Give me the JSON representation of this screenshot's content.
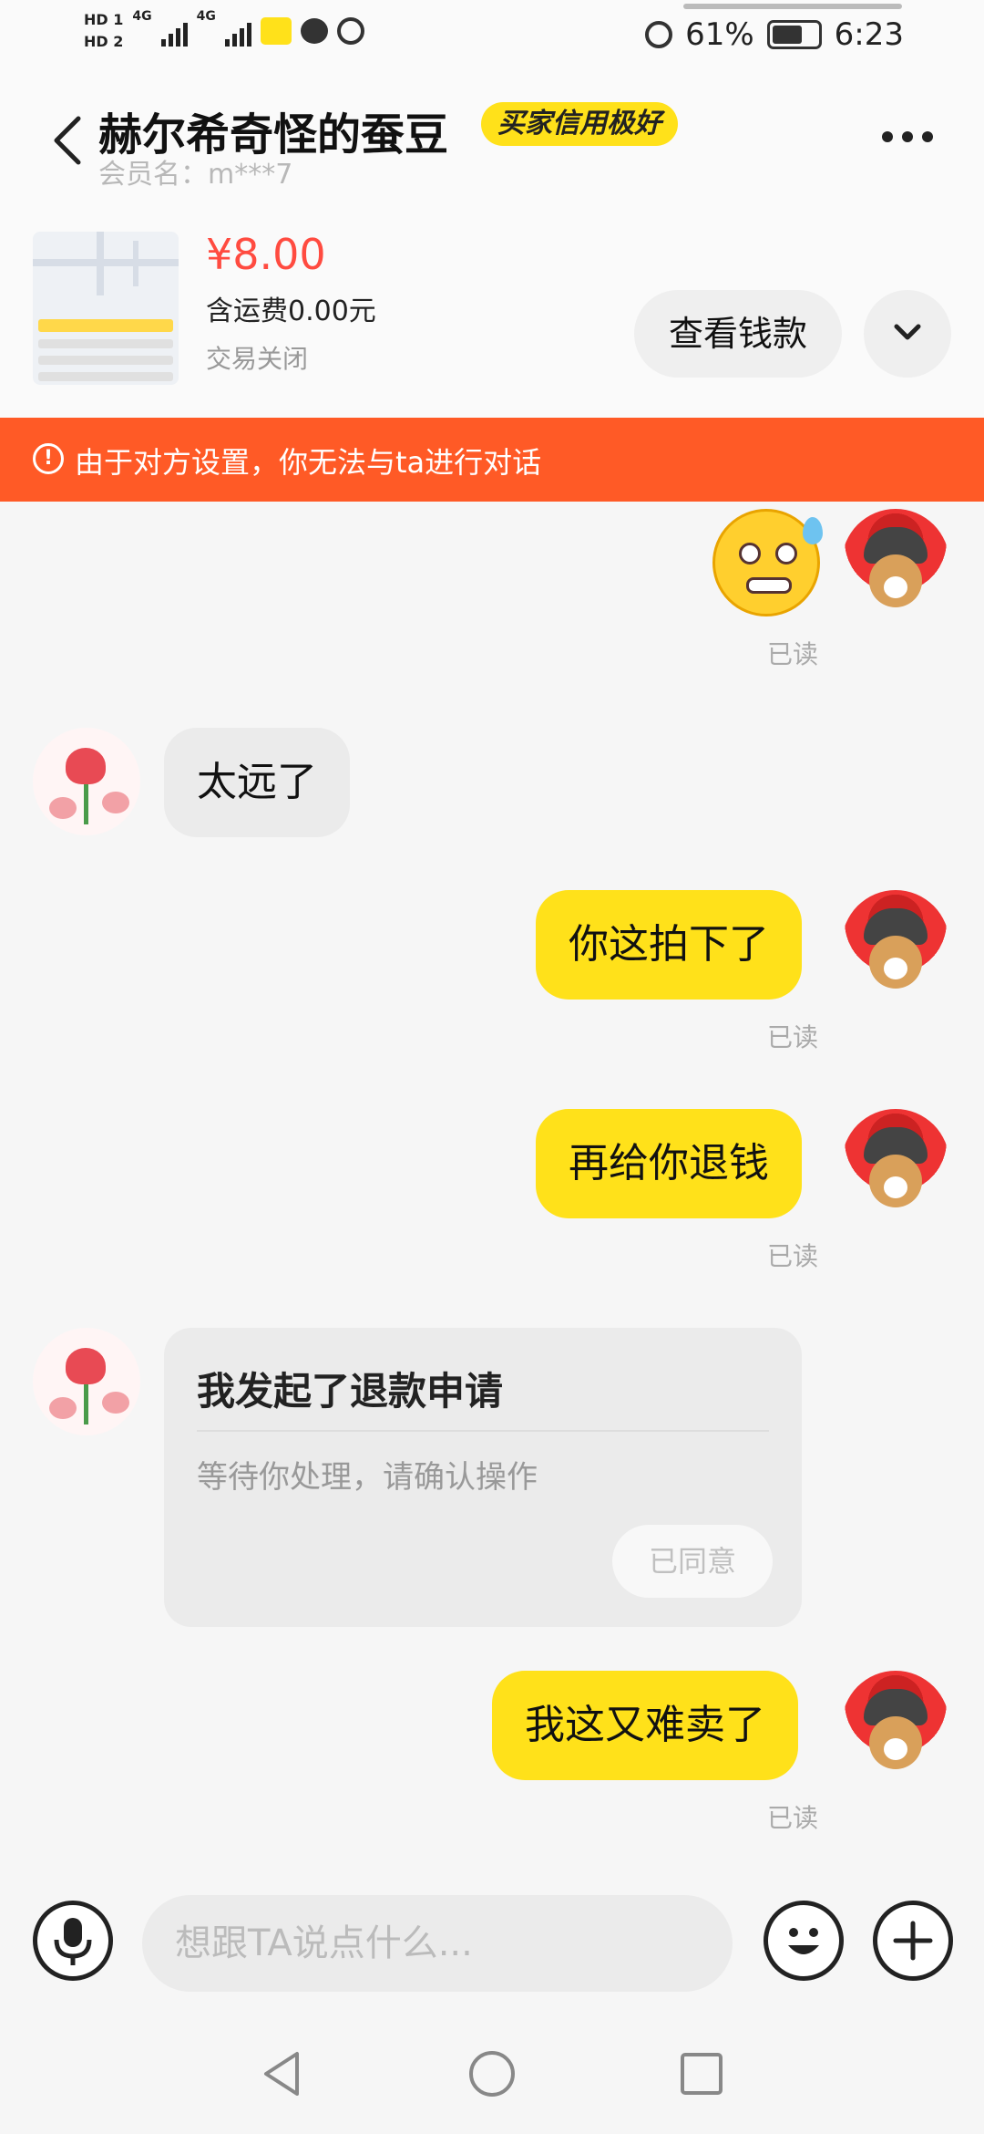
{
  "status_bar": {
    "sim1": "HD 1",
    "sim2": "HD 2",
    "net1": "4G",
    "net2": "4G",
    "battery": "61%",
    "time": "6:23"
  },
  "header": {
    "title": "赫尔希奇怪的蚕豆",
    "badge": "买家信用极好",
    "member": "会员名：m***7"
  },
  "item": {
    "price": "¥8.00",
    "shipping": "含运费0.00元",
    "status": "交易关闭",
    "view_button": "查看钱款"
  },
  "notice": {
    "icon": "!",
    "text": "由于对方设置，你无法与ta进行对话"
  },
  "messages": {
    "read_label": "已读",
    "m2": "太远了",
    "m3": "你这拍下了",
    "m4": "再给你退钱",
    "card_title": "我发起了退款申请",
    "card_sub": "等待你处理，请确认操作",
    "card_button": "已同意",
    "m6": "我这又难卖了"
  },
  "input": {
    "placeholder": "想跟TA说点什么..."
  },
  "colors": {
    "accent": "#ffe11a",
    "notice": "#ff5a26",
    "price": "#ff4b40"
  }
}
